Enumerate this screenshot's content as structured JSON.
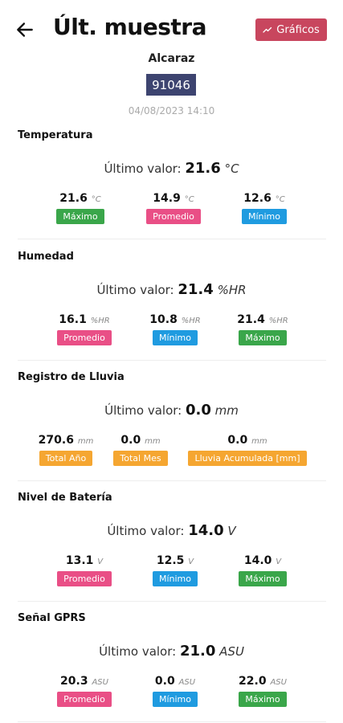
{
  "header": {
    "title": "Últ. muestra",
    "graphs_button": "Gráficos"
  },
  "station": {
    "name": "Alcaraz",
    "code": "91046",
    "datetime": "04/08/2023 14:10"
  },
  "last_value_label": "Último valor:",
  "sections": [
    {
      "title": "Temperatura",
      "last_value": "21.6",
      "unit": "°C",
      "stats": [
        {
          "value": "21.6",
          "unit": "°C",
          "label": "Máximo",
          "color": "green"
        },
        {
          "value": "14.9",
          "unit": "°C",
          "label": "Promedio",
          "color": "pink"
        },
        {
          "value": "12.6",
          "unit": "°C",
          "label": "Mínimo",
          "color": "blue"
        }
      ]
    },
    {
      "title": "Humedad",
      "last_value": "21.4",
      "unit": "%HR",
      "stats": [
        {
          "value": "16.1",
          "unit": "%HR",
          "label": "Promedio",
          "color": "pink"
        },
        {
          "value": "10.8",
          "unit": "%HR",
          "label": "Mínimo",
          "color": "blue"
        },
        {
          "value": "21.4",
          "unit": "%HR",
          "label": "Máximo",
          "color": "green"
        }
      ]
    },
    {
      "title": "Registro de Lluvia",
      "last_value": "0.0",
      "unit": "mm",
      "stats": [
        {
          "value": "270.6",
          "unit": "mm",
          "label": "Total Año",
          "color": "orange"
        },
        {
          "value": "0.0",
          "unit": "mm",
          "label": "Total Mes",
          "color": "orange"
        },
        {
          "value": "0.0",
          "unit": "mm",
          "label": "Lluvia Acumulada [mm]",
          "color": "orange"
        }
      ]
    },
    {
      "title": "Nivel de Batería",
      "last_value": "14.0",
      "unit": "V",
      "stats": [
        {
          "value": "13.1",
          "unit": "V",
          "label": "Promedio",
          "color": "pink"
        },
        {
          "value": "12.5",
          "unit": "V",
          "label": "Mínimo",
          "color": "blue"
        },
        {
          "value": "14.0",
          "unit": "V",
          "label": "Máximo",
          "color": "green"
        }
      ]
    },
    {
      "title": "Señal GPRS",
      "last_value": "21.0",
      "unit": "ASU",
      "stats": [
        {
          "value": "20.3",
          "unit": "ASU",
          "label": "Promedio",
          "color": "pink"
        },
        {
          "value": "0.0",
          "unit": "ASU",
          "label": "Mínimo",
          "color": "blue"
        },
        {
          "value": "22.0",
          "unit": "ASU",
          "label": "Máximo",
          "color": "green"
        }
      ]
    }
  ],
  "colors": {
    "green": "#3aa64a",
    "pink": "#e94f86",
    "blue": "#1f9be0",
    "orange": "#f5a631",
    "graphs_button": "#c8465e",
    "station_code_bg": "#3d4470"
  }
}
